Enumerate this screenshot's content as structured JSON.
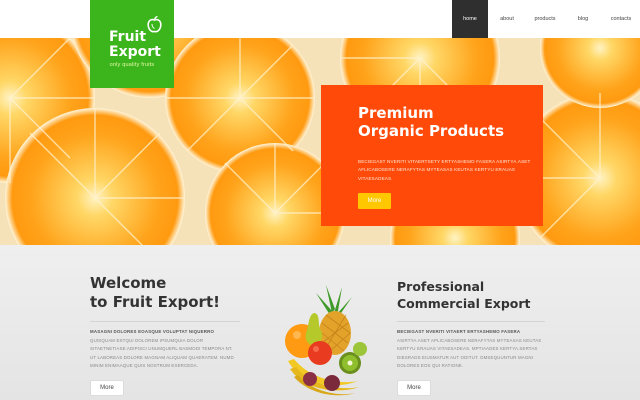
{
  "logo": {
    "line1": "Fruit",
    "line2": "Export",
    "tagline": "only quality fruits"
  },
  "nav": {
    "items": [
      {
        "label": "home",
        "active": true
      },
      {
        "label": "about",
        "active": false
      },
      {
        "label": "products",
        "active": false
      },
      {
        "label": "blog",
        "active": false
      },
      {
        "label": "contacts",
        "active": false
      }
    ]
  },
  "promo": {
    "title_line1": "Premium",
    "title_line2": "Organic Products",
    "text": "BECIEGAST NVERITI VITAERTSETY ERTYASHEMO FASERA ASIRTYA.ASET AFLICABOSERE NERAFYTAS MYTEASAS KEUTAS KERTYU ERAUAS VITAESADEAS.",
    "button": "More"
  },
  "welcome": {
    "title_line1": "Welcome",
    "title_line2": "to Fruit Export!",
    "subheading": "MASAGNI DOLORES EOASQUE VOLUPTAT NIQUERRO",
    "text": "QUISQUAM ESTQUI DOLOREM IPSUMQUIA DOLOR SITAETNETIASE ADIPISCI UNUMQUERL BASMODI TEMPORA NT. UT LABOREAS DOLORE MAGNAM ALIQUAM QUAERATEM. NUMD MINIM ENIMAAQUE QUIS NOSTRUM EXERCEDA.",
    "button": "More"
  },
  "professional": {
    "title_line1": "Professional",
    "title_line2": "Commercial Export",
    "subheading": "BECIEGAST NVERITI VITAERT ERTYASHEMO FASERA",
    "text": "ASIRTYA.ASET APLICABOSERE NERAFYTAS MYTEASAS KEUTAS KERTYU ERAUAS VITAESADEAS. MPTIAADES KERTYA.SERTAS DIESRADS EIUSMATUR AUT ODITUT. OMSEQUUNTUR MAGNI DOLORES EOS QUI RATIONE.",
    "button": "More"
  },
  "colors": {
    "brand_green": "#3cb51c",
    "promo_orange": "#ff4a0a",
    "button_yellow": "#ffc700",
    "nav_active": "#2f2f2f"
  }
}
